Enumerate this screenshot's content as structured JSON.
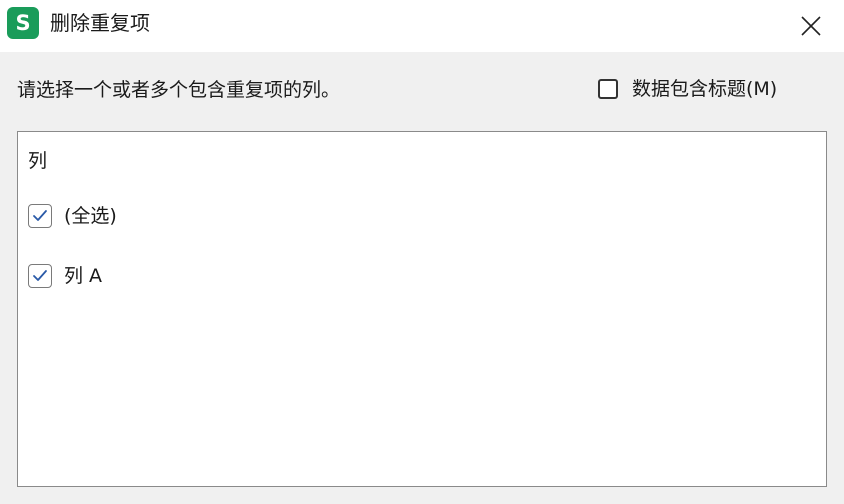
{
  "window": {
    "app_icon_letter": "S",
    "title": "删除重复项",
    "close_icon": "close-icon"
  },
  "instruction": "请选择一个或者多个包含重复项的列。",
  "header_option": {
    "label": "数据包含标题(M)",
    "checked": false
  },
  "list": {
    "header": "列",
    "items": [
      {
        "label": "(全选)",
        "checked": true
      },
      {
        "label": "列 A",
        "checked": true
      }
    ]
  },
  "colors": {
    "app_icon": "#1a9c5a",
    "checkmark": "#2a5aa8",
    "background": "#f0f0f0"
  }
}
